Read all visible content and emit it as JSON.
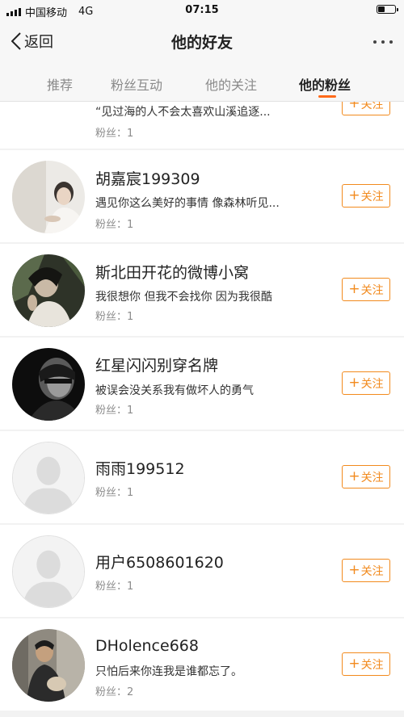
{
  "status": {
    "carrier": "中国移动",
    "network": "4G",
    "time": "07:15",
    "battery_level": 0.4
  },
  "nav": {
    "back_label": "返回",
    "title": "他的好友"
  },
  "tabs": [
    {
      "label": "推荐"
    },
    {
      "label": "粉丝互动"
    },
    {
      "label": "他的关注"
    },
    {
      "label": "他的粉丝"
    }
  ],
  "follow_label": "关注",
  "follow_plus": "+",
  "users": [
    {
      "name": "",
      "bio": "“见过海的人不会太喜欢山溪追逐...",
      "fans": "粉丝：1"
    },
    {
      "name": "胡嘉宸199309",
      "bio": "遇见你这么美好的事情 像森林听见...",
      "fans": "粉丝：1"
    },
    {
      "name": "斯北田开花的微博小窝",
      "bio": "我很想你 但我不会找你 因为我很酷",
      "fans": "粉丝：1"
    },
    {
      "name": "红星闪闪别穿名牌",
      "bio": "被误会没关系我有做坏人的勇气",
      "fans": "粉丝：1"
    },
    {
      "name": "雨雨199512",
      "bio": "",
      "fans": "粉丝：1"
    },
    {
      "name": "用户6508601620",
      "bio": "",
      "fans": "粉丝：1"
    },
    {
      "name": "DHolence668",
      "bio": "只怕后来你连我是谁都忘了。",
      "fans": "粉丝：2"
    }
  ]
}
